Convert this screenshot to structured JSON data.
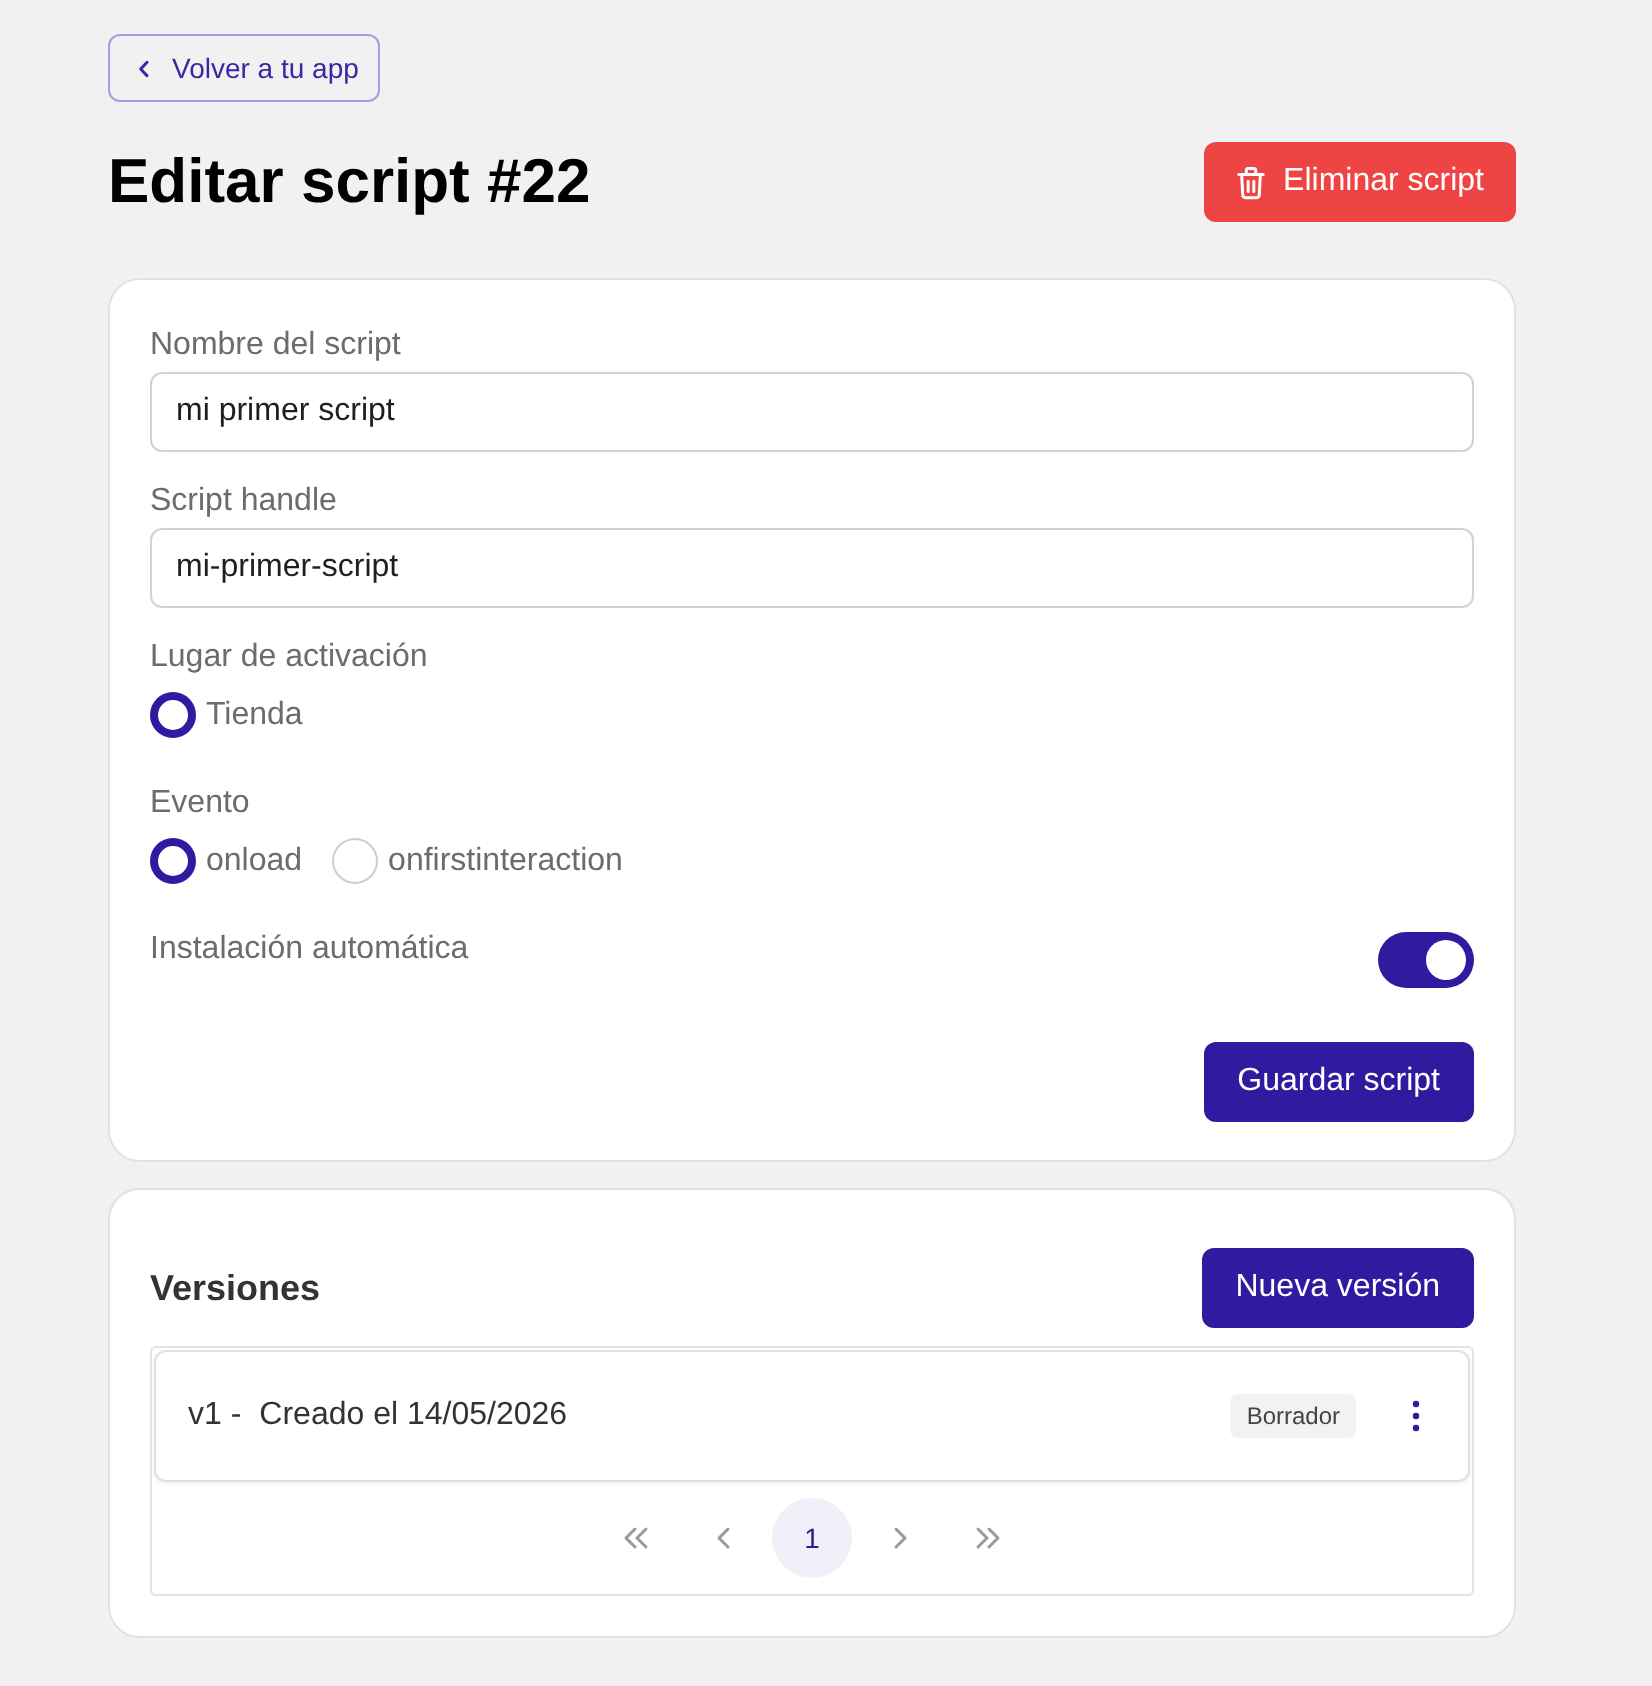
{
  "back_link": {
    "label": "Volver a tu app"
  },
  "title": "Editar script #22",
  "delete_button": {
    "label": "Eliminar script"
  },
  "form": {
    "fields": [
      {
        "label": "Nombre del script",
        "value": "mi primer script"
      },
      {
        "label": "Script handle",
        "value": "mi-primer-script"
      }
    ],
    "radio_groups": [
      {
        "label": "Lugar de activación",
        "options": [
          {
            "label": "Tienda",
            "selected": true
          }
        ]
      },
      {
        "label": "Evento",
        "options": [
          {
            "label": "onload",
            "selected": true
          },
          {
            "label": "onfirstinteraction",
            "selected": false
          }
        ]
      }
    ],
    "toggle": {
      "label": "Instalación automática",
      "on": true
    },
    "save_button": {
      "label": "Guardar script"
    }
  },
  "versions": {
    "title": "Versiones",
    "new_button": {
      "label": "Nueva versión"
    },
    "items": [
      {
        "version": "v1 -",
        "created": "Creado el 14/05/2026",
        "status": "Borrador"
      }
    ],
    "pagination": {
      "pages": [
        {
          "label": "1",
          "selected": true
        }
      ]
    }
  }
}
